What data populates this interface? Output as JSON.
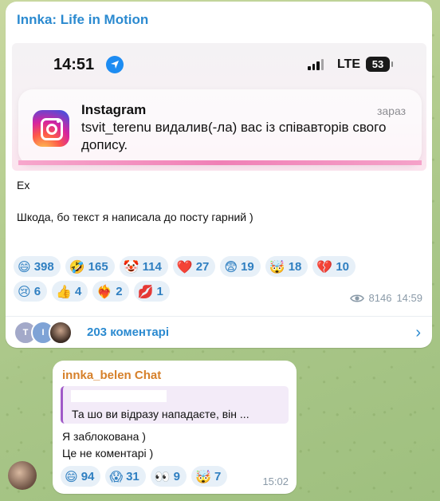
{
  "channel": {
    "name": "Innka: Life in Motion"
  },
  "screenshot": {
    "time": "14:51",
    "network": "LTE",
    "battery": "53",
    "notification": {
      "app": "Instagram",
      "when": "зараз",
      "body": "tsvit_terenu видалив(-ла) вас із співавторів свого допису."
    }
  },
  "post": {
    "line1": "Ех",
    "line2": "Шкода, бо текст я написала до посту гарний )"
  },
  "reactions_row1": [
    {
      "emoji": "😄",
      "count": "398"
    },
    {
      "emoji": "🤣",
      "count": "165"
    },
    {
      "emoji": "🤡",
      "count": "114"
    },
    {
      "emoji": "❤️",
      "count": "27"
    },
    {
      "emoji": "😨",
      "count": "19"
    },
    {
      "emoji": "🤯",
      "count": "18"
    },
    {
      "emoji": "💔",
      "count": "10"
    }
  ],
  "reactions_row2": [
    {
      "emoji": "😢",
      "count": "6"
    },
    {
      "emoji": "👍",
      "count": "4"
    },
    {
      "emoji": "❤️‍🔥",
      "count": "2"
    },
    {
      "emoji": "💋",
      "count": "1"
    }
  ],
  "meta": {
    "views": "8146",
    "time": "14:59"
  },
  "comments": {
    "label": "203 коментарі",
    "avatars": [
      "T",
      "I"
    ]
  },
  "reply": {
    "author": "innka_belen Chat",
    "quote": "Та шо ви відразу нападаєте, він ...",
    "line1": "Я заблокована )",
    "line2": "Це не коментарі )",
    "reactions": [
      {
        "emoji": "😄",
        "count": "94"
      },
      {
        "emoji": "😱",
        "count": "31"
      },
      {
        "emoji": "👀",
        "count": "9"
      },
      {
        "emoji": "🤯",
        "count": "7"
      }
    ],
    "time": "15:02"
  },
  "colors": {
    "link": "#2b8ad0",
    "reply_author": "#d6802a",
    "quote_bar": "#a05ac8"
  }
}
